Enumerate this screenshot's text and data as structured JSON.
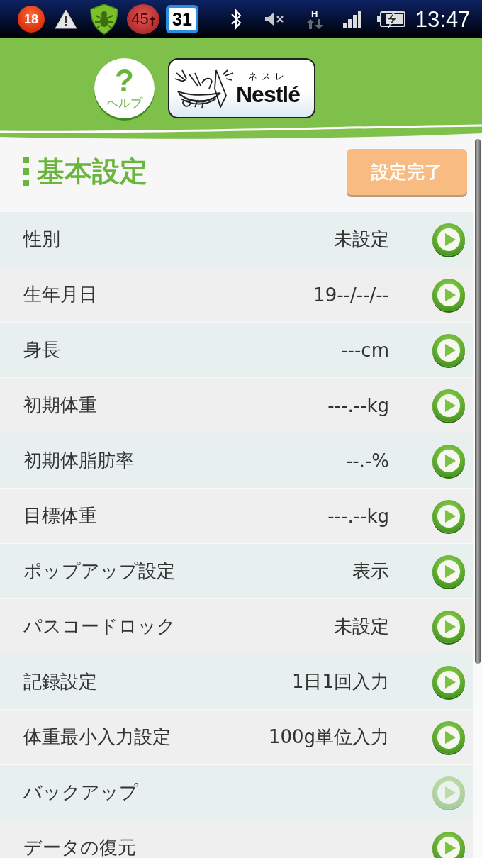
{
  "status_bar": {
    "notification_count": "18",
    "temperature": "45",
    "calendar_day": "31",
    "network_type": "H",
    "time": "13:47"
  },
  "header": {
    "help_button": {
      "symbol": "?",
      "label": "ヘルプ"
    },
    "logo": {
      "kana": "ネスレ",
      "wordmark": "Nestlé"
    }
  },
  "section": {
    "title": "基本設定",
    "done_button": "設定完了"
  },
  "rows": [
    {
      "label": "性別",
      "value": "未設定",
      "disabled": false
    },
    {
      "label": "生年月日",
      "value": "19--/--/--",
      "disabled": false
    },
    {
      "label": "身長",
      "value": "---cm",
      "disabled": false
    },
    {
      "label": "初期体重",
      "value": "---.--kg",
      "disabled": false
    },
    {
      "label": "初期体脂肪率",
      "value": "--.-%",
      "disabled": false
    },
    {
      "label": "目標体重",
      "value": "---.--kg",
      "disabled": false
    },
    {
      "label": "ポップアップ設定",
      "value": "表示",
      "disabled": false
    },
    {
      "label": "パスコードロック",
      "value": "未設定",
      "disabled": false
    },
    {
      "label": "記録設定",
      "value": "1日1回入力",
      "disabled": false
    },
    {
      "label": "体重最小入力設定",
      "value": "100g単位入力",
      "disabled": false
    },
    {
      "label": "バックアップ",
      "disabled": true
    },
    {
      "label": "データの復元",
      "disabled": false
    }
  ]
}
